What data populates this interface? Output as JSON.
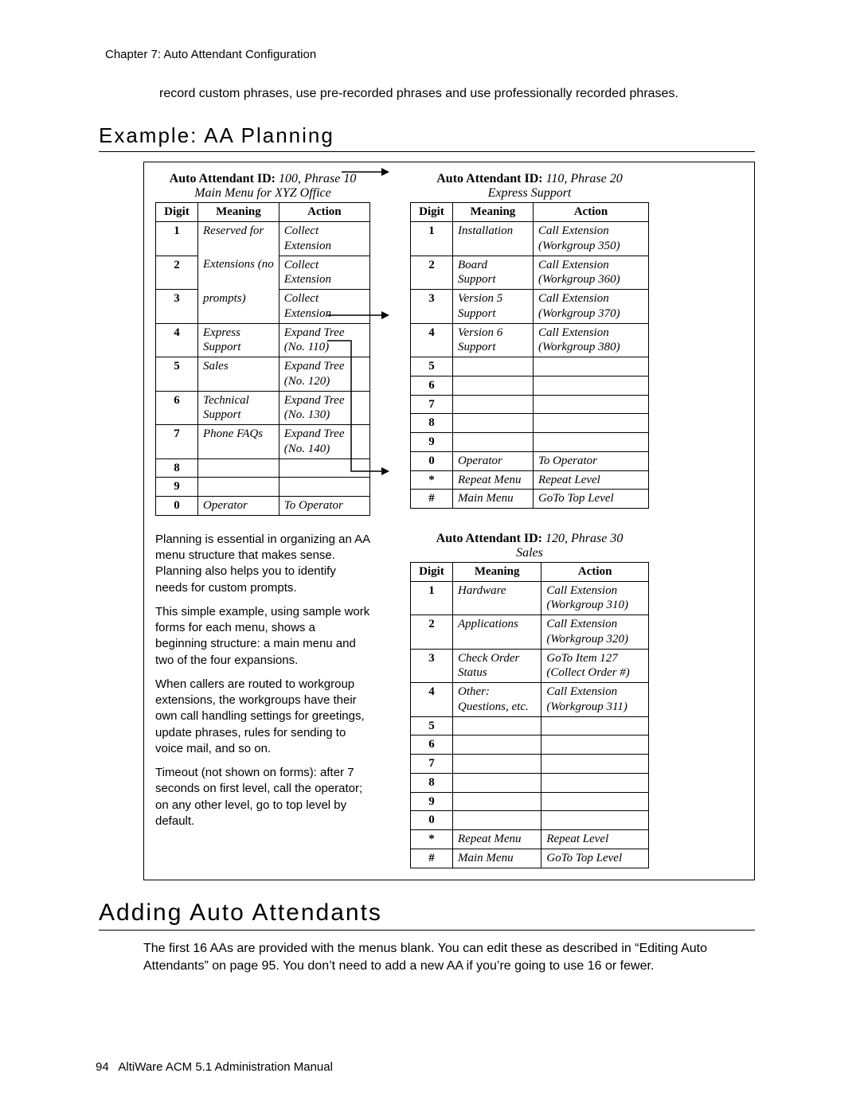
{
  "chapter_header": "Chapter 7:  Auto Attendant Configuration",
  "intro_paragraph": "record custom phrases, use pre-recorded phrases and use professionally recorded phrases.",
  "section1_heading": "Example: AA Planning",
  "table1": {
    "id_label": "Auto Attendant ID:",
    "id_value": "100, Phrase 10",
    "subtitle": "Main Menu for XYZ Office",
    "headers": {
      "digit": "Digit",
      "meaning": "Meaning",
      "action": "Action"
    },
    "rows": [
      {
        "digit": "1",
        "meaning": "Reserved for",
        "action": "Collect Extension"
      },
      {
        "digit": "2",
        "meaning": "Extensions (no",
        "action": "Collect Extension"
      },
      {
        "digit": "3",
        "meaning": "prompts)",
        "action": "Collect Extension"
      },
      {
        "digit": "4",
        "meaning": "Express Support",
        "action": "Expand Tree (No. 110)"
      },
      {
        "digit": "5",
        "meaning": "Sales",
        "action": "Expand Tree (No. 120)"
      },
      {
        "digit": "6",
        "meaning": "Technical Support",
        "action": "Expand Tree (No. 130)"
      },
      {
        "digit": "7",
        "meaning": "Phone FAQs",
        "action": "Expand Tree (No. 140)"
      },
      {
        "digit": "8",
        "meaning": "",
        "action": ""
      },
      {
        "digit": "9",
        "meaning": "",
        "action": ""
      },
      {
        "digit": "0",
        "meaning": "Operator",
        "action": "To Operator"
      }
    ]
  },
  "table2": {
    "id_label": "Auto Attendant ID:",
    "id_value": "110, Phrase 20",
    "subtitle": "Express Support",
    "headers": {
      "digit": "Digit",
      "meaning": "Meaning",
      "action": "Action"
    },
    "rows": [
      {
        "digit": "1",
        "meaning": "Installation",
        "action": "Call Extension (Workgroup 350)"
      },
      {
        "digit": "2",
        "meaning": "Board Support",
        "action": "Call Extension (Workgroup 360)"
      },
      {
        "digit": "3",
        "meaning": "Version 5 Support",
        "action": "Call Extension (Workgroup 370)"
      },
      {
        "digit": "4",
        "meaning": "Version 6 Support",
        "action": "Call Extension (Workgroup 380)"
      },
      {
        "digit": "5",
        "meaning": "",
        "action": ""
      },
      {
        "digit": "6",
        "meaning": "",
        "action": ""
      },
      {
        "digit": "7",
        "meaning": "",
        "action": ""
      },
      {
        "digit": "8",
        "meaning": "",
        "action": ""
      },
      {
        "digit": "9",
        "meaning": "",
        "action": ""
      },
      {
        "digit": "0",
        "meaning": "Operator",
        "action": "To Operator"
      },
      {
        "digit": "*",
        "meaning": "Repeat Menu",
        "action": "Repeat Level"
      },
      {
        "digit": "#",
        "meaning": "Main Menu",
        "action": "GoTo Top Level"
      }
    ]
  },
  "table3": {
    "id_label": "Auto Attendant ID:",
    "id_value": "120, Phrase 30",
    "subtitle": "Sales",
    "headers": {
      "digit": "Digit",
      "meaning": "Meaning",
      "action": "Action"
    },
    "rows": [
      {
        "digit": "1",
        "meaning": "Hardware",
        "action": "Call Extension (Workgroup 310)"
      },
      {
        "digit": "2",
        "meaning": "Applications",
        "action": "Call Extension (Workgroup 320)"
      },
      {
        "digit": "3",
        "meaning": "Check Order Status",
        "action": "GoTo Item 127 (Collect Order #)"
      },
      {
        "digit": "4",
        "meaning": "Other: Questions, etc.",
        "action": "Call Extension (Workgroup 311)"
      },
      {
        "digit": "5",
        "meaning": "",
        "action": ""
      },
      {
        "digit": "6",
        "meaning": "",
        "action": ""
      },
      {
        "digit": "7",
        "meaning": "",
        "action": ""
      },
      {
        "digit": "8",
        "meaning": "",
        "action": ""
      },
      {
        "digit": "9",
        "meaning": "",
        "action": ""
      },
      {
        "digit": "0",
        "meaning": "",
        "action": ""
      },
      {
        "digit": "*",
        "meaning": "Repeat Menu",
        "action": "Repeat Level"
      },
      {
        "digit": "#",
        "meaning": "Main Menu",
        "action": "GoTo Top Level"
      }
    ]
  },
  "para1": "Planning is essential in organizing an AA menu structure that makes sense. Planning also helps you to identify needs for custom prompts.",
  "para2": "This simple example, using sample work forms for each menu, shows a beginning structure: a main menu and two of the four expansions.",
  "para3": "When callers are routed to workgroup extensions, the workgroups have their own call handling settings for greetings, update phrases, rules for sending to voice mail, and so on.",
  "para4": "Timeout (not shown on forms): after 7 seconds on first level, call the operator; on any other level, go to top level by default.",
  "section2_heading": "Adding Auto Attendants",
  "section2_para": "The first 16 AAs are provided with the menus blank. You can edit these as described in “Editing Auto Attendants” on page 95. You don’t need to add a new AA if you’re going to use 16 or fewer.",
  "footer_page": "94",
  "footer_text": "AltiWare ACM 5.1 Administration Manual"
}
